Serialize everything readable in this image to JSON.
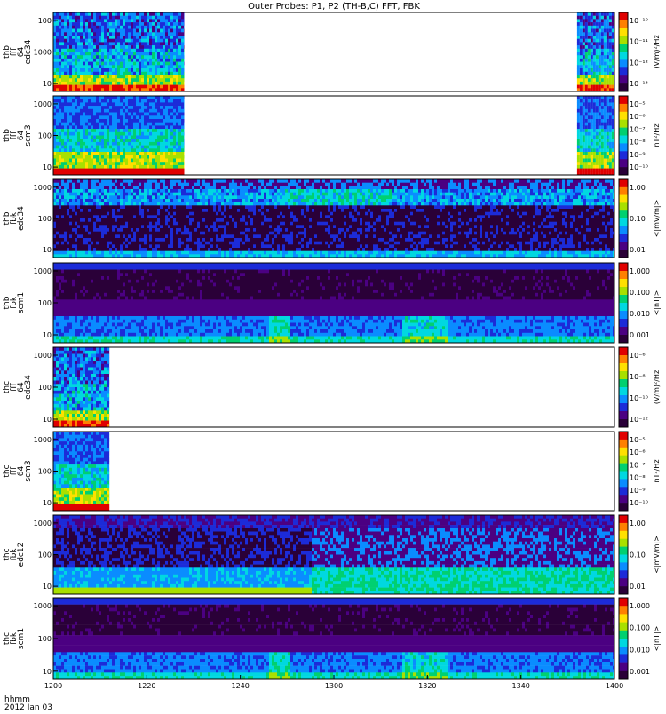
{
  "title": "Outer Probes: P1, P2 (TH-B,C) FFT, FBK",
  "x_axis": {
    "label_line1": "hhmm",
    "label_line2": "2012 Jan 03",
    "ticks": [
      "1200",
      "1220",
      "1240",
      "1300",
      "1320",
      "1340",
      "1400"
    ],
    "range_minutes": [
      0,
      120
    ]
  },
  "colors": {
    "rainbow": [
      "#2a0038",
      "#4b0082",
      "#1c2bd8",
      "#0a8cff",
      "#00d8e0",
      "#00d070",
      "#a8e000",
      "#ffe000",
      "#ff8000",
      "#e00000"
    ]
  },
  "chart_data": [
    {
      "type": "heatmap",
      "name": "thb-fff-edc34",
      "ylabel": [
        "thb",
        "fff",
        "64",
        "edc34"
      ],
      "yticks": [
        "100",
        "1000",
        "10"
      ],
      "colorbar": {
        "ticks": [
          "10⁻¹⁰",
          "10⁻¹¹",
          "10⁻¹²",
          "10⁻¹³"
        ],
        "label": "(V/m)²/Hz"
      },
      "data_intervals_minutes": [
        [
          0,
          28
        ],
        [
          112,
          120
        ]
      ],
      "style": "fft-e"
    },
    {
      "type": "heatmap",
      "name": "thb-fff-scm3",
      "ylabel": [
        "thb",
        "fff",
        "64",
        "scm3"
      ],
      "yticks": [
        "1000",
        "100",
        "10"
      ],
      "colorbar": {
        "ticks": [
          "10⁻⁵",
          "10⁻⁶",
          "10⁻⁷",
          "10⁻⁸",
          "10⁻⁹",
          "10⁻¹⁰"
        ],
        "label": "nT²/Hz"
      },
      "data_intervals_minutes": [
        [
          0,
          28
        ],
        [
          112,
          120
        ]
      ],
      "style": "fft-b"
    },
    {
      "type": "heatmap",
      "name": "thb-fbk-edc34",
      "ylabel": [
        "thb",
        "fbk",
        "edc34"
      ],
      "yticks": [
        "1000",
        "100",
        "10"
      ],
      "colorbar": {
        "ticks": [
          "1.00",
          "0.10",
          "0.01"
        ],
        "label": "<|mV/m|>"
      },
      "data_intervals_minutes": [
        [
          0,
          120
        ]
      ],
      "style": "fbk-e"
    },
    {
      "type": "heatmap",
      "name": "thb-fbk-scm1",
      "ylabel": [
        "thb",
        "fbk",
        "scm1"
      ],
      "yticks": [
        "1000",
        "100",
        "10"
      ],
      "colorbar": {
        "ticks": [
          "1.000",
          "0.100",
          "0.010",
          "0.001"
        ],
        "label": "<|nT|>"
      },
      "data_intervals_minutes": [
        [
          0,
          120
        ]
      ],
      "style": "fbk-b"
    },
    {
      "type": "heatmap",
      "name": "thc-fff-edc34",
      "ylabel": [
        "thc",
        "fff",
        "64",
        "edc34"
      ],
      "yticks": [
        "1000",
        "100",
        "10"
      ],
      "colorbar": {
        "ticks": [
          "10⁻⁶",
          "10⁻⁸",
          "10⁻¹⁰",
          "10⁻¹²"
        ],
        "label": "(V/m)²/Hz"
      },
      "data_intervals_minutes": [
        [
          0,
          12
        ]
      ],
      "style": "fft-e"
    },
    {
      "type": "heatmap",
      "name": "thc-fff-scm3",
      "ylabel": [
        "thc",
        "fff",
        "64",
        "scm3"
      ],
      "yticks": [
        "1000",
        "100",
        "10"
      ],
      "colorbar": {
        "ticks": [
          "10⁻⁵",
          "10⁻⁶",
          "10⁻⁷",
          "10⁻⁸",
          "10⁻⁹",
          "10⁻¹⁰"
        ],
        "label": "nT²/Hz"
      },
      "data_intervals_minutes": [
        [
          0,
          12
        ]
      ],
      "style": "fft-b"
    },
    {
      "type": "heatmap",
      "name": "thc-fbk-edc12",
      "ylabel": [
        "thc",
        "fbk",
        "edc12"
      ],
      "yticks": [
        "1000",
        "100",
        "10"
      ],
      "colorbar": {
        "ticks": [
          "1.00",
          "0.10",
          "0.01"
        ],
        "label": "<|mV/m|>"
      },
      "data_intervals_minutes": [
        [
          0,
          120
        ]
      ],
      "style": "fbk-e2"
    },
    {
      "type": "heatmap",
      "name": "thc-fbk-scm1",
      "ylabel": [
        "thc",
        "fbk",
        "scm1"
      ],
      "yticks": [
        "1000",
        "100",
        "10"
      ],
      "colorbar": {
        "ticks": [
          "1.000",
          "0.100",
          "0.010",
          "0.001"
        ],
        "label": "<|nT|>"
      },
      "data_intervals_minutes": [
        [
          0,
          120
        ]
      ],
      "style": "fbk-b"
    }
  ]
}
